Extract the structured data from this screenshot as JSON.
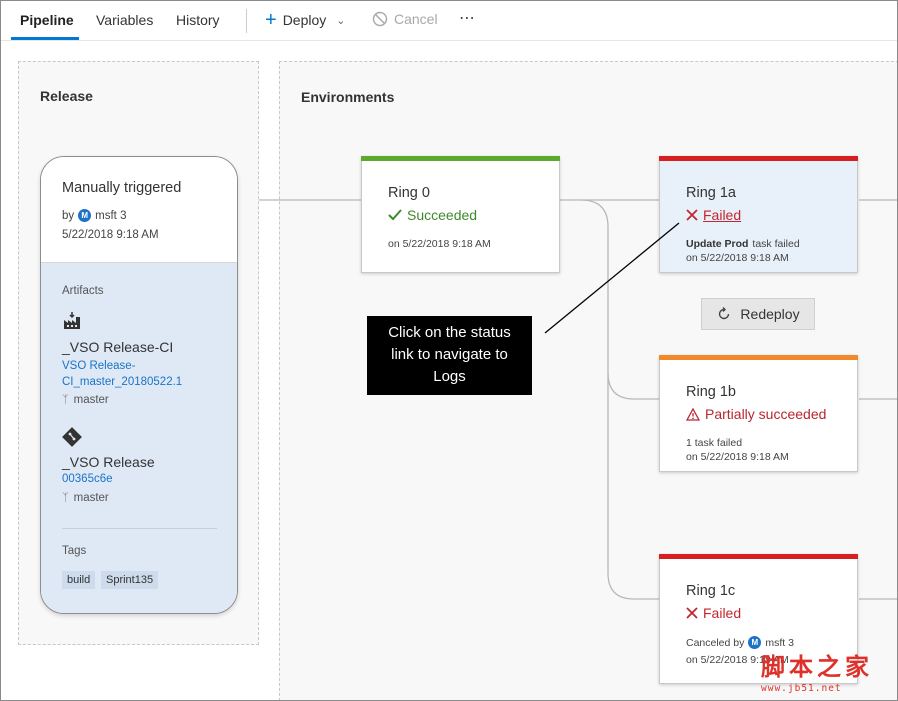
{
  "toolbar": {
    "tabs": [
      {
        "label": "Pipeline",
        "active": true
      },
      {
        "label": "Variables",
        "active": false
      },
      {
        "label": "History",
        "active": false
      }
    ],
    "deploy_label": "Deploy",
    "cancel_label": "Cancel",
    "more_label": "⋯",
    "accent_color": "#0078d4"
  },
  "release": {
    "section_title": "Release",
    "card_title": "Manually triggered",
    "by_label": "by",
    "avatar_initial": "M",
    "user": "msft 3",
    "date": "5/22/2018 9:18 AM",
    "artifacts_label": "Artifacts",
    "artifacts": [
      {
        "name": "_VSO Release-CI",
        "link_line1": "VSO Release-",
        "link_line2": "CI_master_20180522.1",
        "branch": "master",
        "icon": "build-artifact-icon"
      },
      {
        "name": "_VSO Release",
        "link_line1": "00365c6e",
        "branch": "master",
        "icon": "git-icon"
      }
    ],
    "tags_label": "Tags",
    "tags": [
      "build",
      "Sprint135"
    ]
  },
  "environments": {
    "section_title": "Environments",
    "items": [
      {
        "name": "Ring 0",
        "status": "Succeeded",
        "status_icon": "check-icon",
        "date": "on 5/22/2018 9:18 AM",
        "bar_color": "#5fa82e"
      },
      {
        "name": "Ring 1a",
        "status": "Failed",
        "status_icon": "x-icon",
        "detail_bold": "Update Prod",
        "detail_rest": " task failed",
        "date": "on 5/22/2018 9:18 AM",
        "bar_color": "#d71f20"
      },
      {
        "name": "Ring 1b",
        "status": "Partially succeeded",
        "status_icon": "warning-icon",
        "detail_rest": "1 task failed",
        "date": "on 5/22/2018 9:18 AM",
        "bar_color": "#f28a2b"
      },
      {
        "name": "Ring 1c",
        "status": "Failed",
        "status_icon": "x-icon",
        "detail_rest": "Canceled by",
        "detail_avatar": "M",
        "detail_user": "msft 3",
        "date": "on 5/22/2018 9:18 AM",
        "bar_color": "#d71f20"
      }
    ],
    "redeploy_label": "Redeploy"
  },
  "callout": {
    "line1": "Click on the status",
    "line2": "link to navigate to",
    "line3": "Logs"
  },
  "watermark": {
    "cn": "脚本之家",
    "url": "www.jb51.net"
  }
}
